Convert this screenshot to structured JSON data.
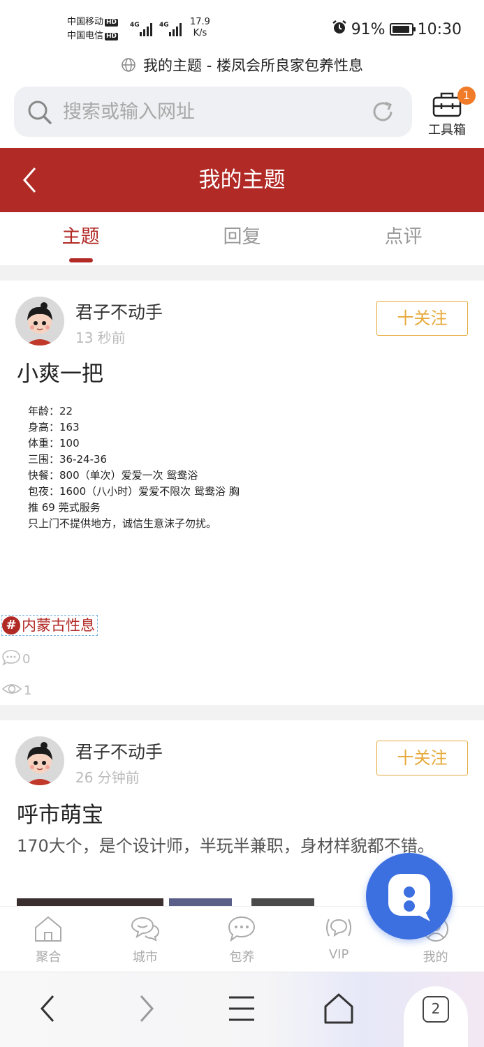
{
  "status_bar": {
    "carrier1": "中国移动",
    "carrier2": "中国电信",
    "hd": "HD",
    "network": "4G",
    "speed_value": "17.9",
    "speed_unit": "K/s",
    "battery_percent": "91%",
    "battery_level": 0.91,
    "time": "10:30",
    "icons": [
      "alarm-icon",
      "signal-icon",
      "battery-icon"
    ]
  },
  "page_title": "我的主题 - 楼凤会所良家包养性息",
  "search": {
    "placeholder": "搜索或输入网址"
  },
  "toolbox": {
    "label": "工具箱",
    "badge": "1"
  },
  "header": {
    "title": "我的主题"
  },
  "tabs": [
    {
      "label": "主题",
      "active": true
    },
    {
      "label": "回复",
      "active": false
    },
    {
      "label": "点评",
      "active": false
    }
  ],
  "posts": [
    {
      "author": "君子不动手",
      "time": "13 秒前",
      "follow_label": "十关注",
      "title": "小爽一把",
      "image_text": [
        "年龄：22",
        "身高：163",
        "体重：100",
        "三围：36-24-36",
        "快餐：800（单次）爱爱一次 鸳鸯浴",
        "",
        "包夜：1600（八小时）爱爱不限次 鸳鸯浴 胸",
        "推 69 莞式服务",
        "",
        "只上门不提供地方，诚信生意沫子勿扰。"
      ],
      "tag_hash": "#",
      "tag": "内蒙古性息",
      "comments": "0",
      "views": "1"
    },
    {
      "author": "君子不动手",
      "time": "26 分钟前",
      "follow_label": "十关注",
      "title": "呼市萌宝",
      "description": "170大个，是个设计师，半玩半兼职，身材样貌都不错。"
    }
  ],
  "site_nav": [
    {
      "label": "聚合",
      "icon": "home-icon"
    },
    {
      "label": "城市",
      "icon": "chat-bubbles-icon"
    },
    {
      "label": "包养",
      "icon": "chat-dots-icon"
    },
    {
      "label": "VIP",
      "icon": "vip-signal-icon"
    },
    {
      "label": "我的",
      "icon": "profile-icon"
    }
  ],
  "browser_bar": {
    "tab_count": "2"
  },
  "colors": {
    "brand_red": "#b12a26",
    "follow_orange": "#e6a93a",
    "badge_orange": "#f07b29",
    "fab_blue": "#3c6fe0"
  }
}
